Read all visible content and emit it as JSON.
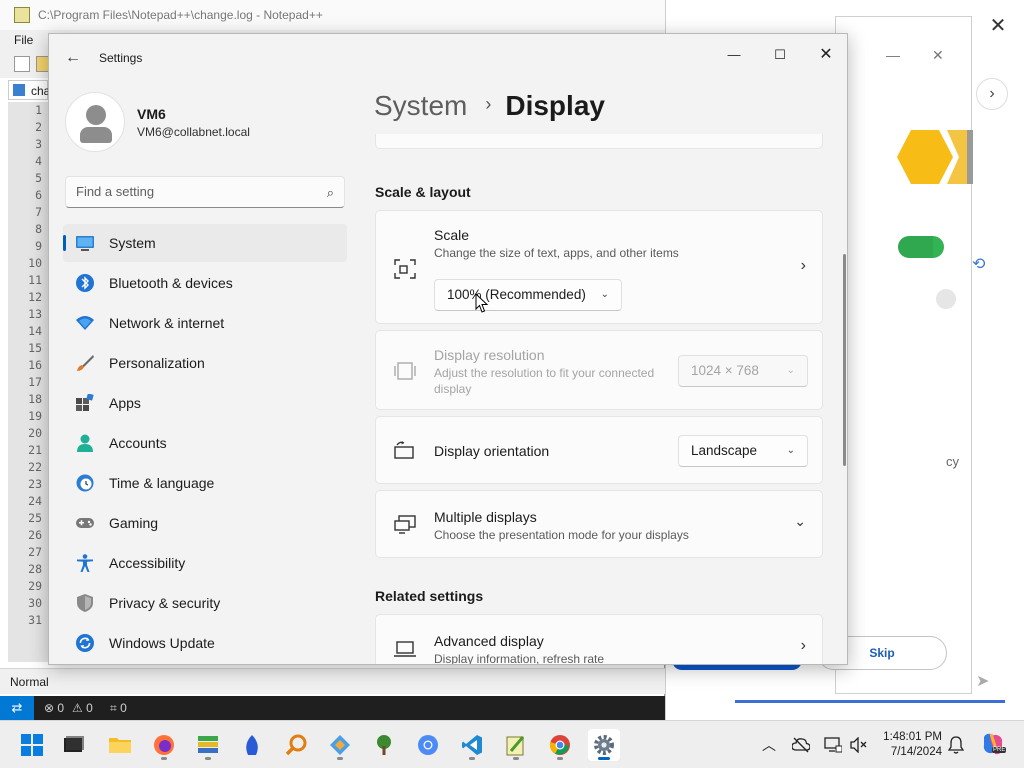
{
  "notepadpp": {
    "title": "C:\\Program Files\\Notepad++\\change.log - Notepad++",
    "menu_file": "File",
    "tab_label": "cha",
    "line_numbers": [
      "1",
      "2",
      "3",
      "4",
      "5",
      "6",
      "7",
      "8",
      "9",
      "10",
      "11",
      "12",
      "13",
      "14",
      "15",
      "16",
      "17",
      "18",
      "19",
      "20",
      "21",
      "22",
      "23",
      "24",
      "25",
      "26",
      "27",
      "28",
      "29",
      "30",
      "31"
    ],
    "status_mode": "Normal"
  },
  "vscode_status": {
    "errors": "0",
    "warnings": "0",
    "ports": "0"
  },
  "chrome": {
    "title": "Google Chrome",
    "skip_label": "Skip",
    "side_label": "cy"
  },
  "settings": {
    "app_title": "Settings",
    "user": {
      "name": "VM6",
      "email": "VM6@collabnet.local"
    },
    "search_placeholder": "Find a setting",
    "nav": [
      {
        "label": "System",
        "icon": "monitor-icon",
        "active": true
      },
      {
        "label": "Bluetooth & devices",
        "icon": "bluetooth-icon"
      },
      {
        "label": "Network & internet",
        "icon": "wifi-icon"
      },
      {
        "label": "Personalization",
        "icon": "brush-icon"
      },
      {
        "label": "Apps",
        "icon": "apps-icon"
      },
      {
        "label": "Accounts",
        "icon": "person-icon"
      },
      {
        "label": "Time & language",
        "icon": "globe-clock-icon"
      },
      {
        "label": "Gaming",
        "icon": "gamepad-icon"
      },
      {
        "label": "Accessibility",
        "icon": "accessibility-icon"
      },
      {
        "label": "Privacy & security",
        "icon": "shield-icon"
      },
      {
        "label": "Windows Update",
        "icon": "update-icon"
      }
    ],
    "breadcrumb": {
      "parent": "System",
      "current": "Display"
    },
    "section_scale": "Scale & layout",
    "scale": {
      "title": "Scale",
      "subtitle": "Change the size of text, apps, and other items",
      "value": "100% (Recommended)"
    },
    "resolution": {
      "title": "Display resolution",
      "subtitle": "Adjust the resolution to fit your connected display",
      "value": "1024 × 768"
    },
    "orientation": {
      "title": "Display orientation",
      "value": "Landscape"
    },
    "multiple": {
      "title": "Multiple displays",
      "subtitle": "Choose the presentation mode for your displays"
    },
    "section_related": "Related settings",
    "advanced": {
      "title": "Advanced display",
      "subtitle": "Display information, refresh rate"
    }
  },
  "taskbar": {
    "time": "1:48:01 PM",
    "date": "7/14/2024",
    "copilot_badge": "PRE"
  }
}
